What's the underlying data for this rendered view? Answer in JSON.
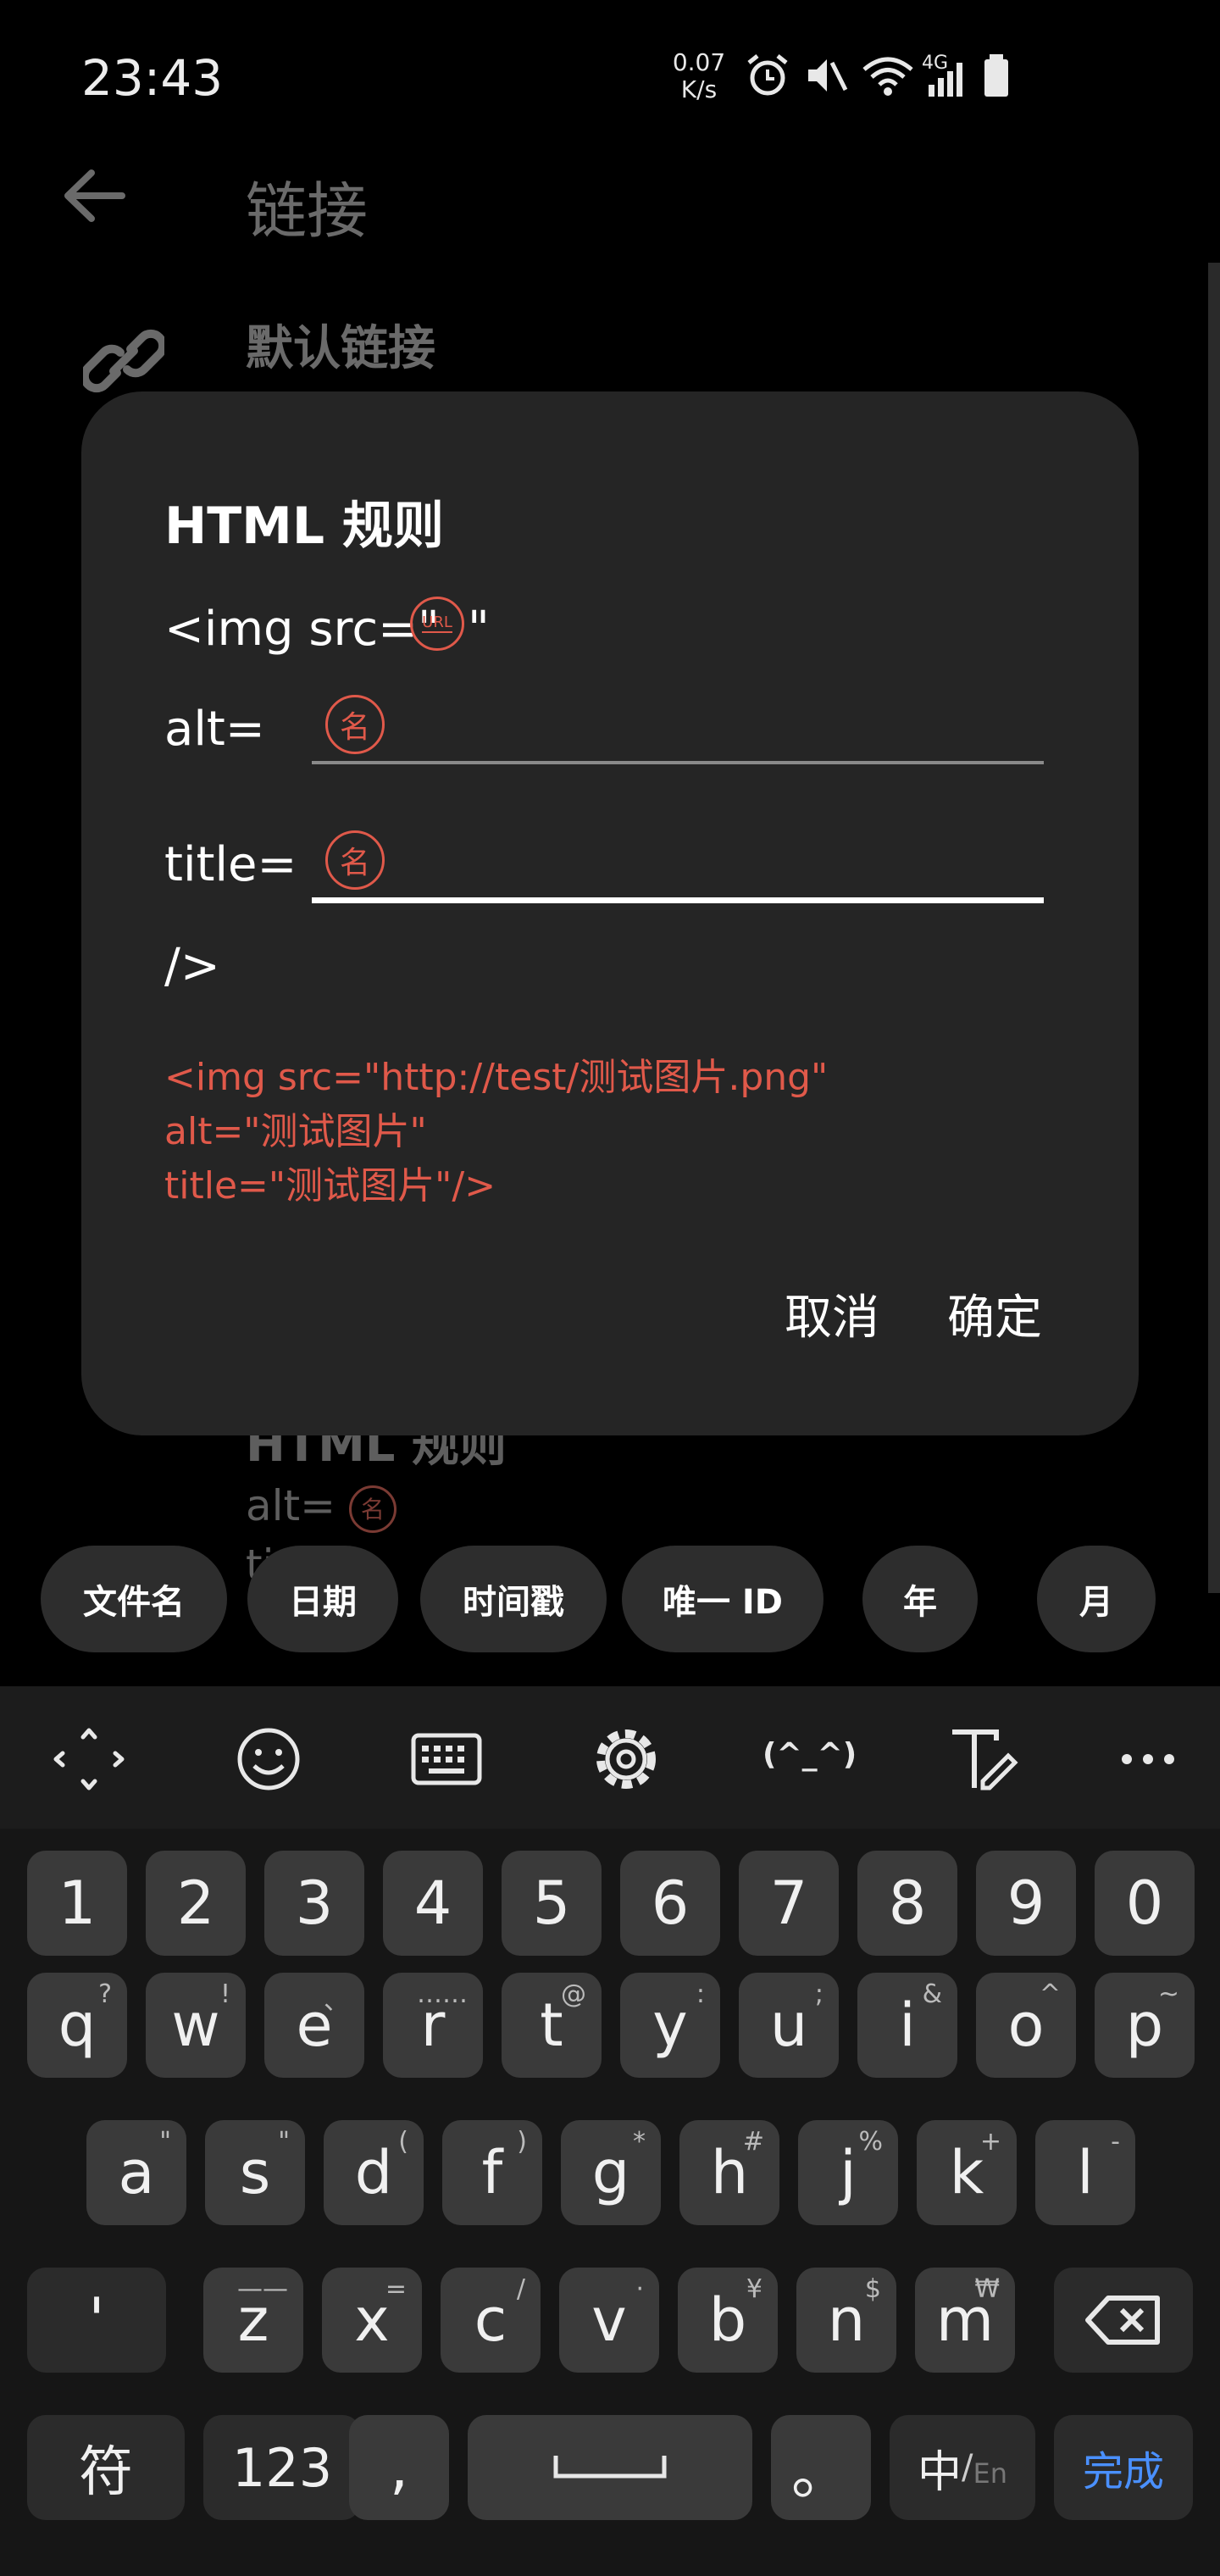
{
  "status_bar": {
    "time": "23:43",
    "net_speed_value": "0.07",
    "net_speed_unit": "K/s",
    "signal_label": "4G"
  },
  "background": {
    "page_title": "链接",
    "default_link_label": "默认链接",
    "html_rule_label": "HTML 规则",
    "alt_label": "alt=",
    "title_label": "ti"
  },
  "dialog": {
    "title": "HTML 规则",
    "img_open": "<img src=\"",
    "url_badge": "URL",
    "quote": "\"",
    "alt_label": "alt=",
    "title_label": "title=",
    "name_badge": "名",
    "close_tag": "/>",
    "preview": {
      "line1": "<img src=\"http://test/测试图片.png\"",
      "line2": "alt=\"测试图片\"",
      "line3": "title=\"测试图片\"/>"
    },
    "cancel": "取消",
    "confirm": "确定"
  },
  "chips": [
    "文件名",
    "日期",
    "时间戳",
    "唯一 ID",
    "年",
    "月"
  ],
  "keyboard": {
    "toolbar": [
      "move-icon",
      "emoji-icon",
      "keyboard-icon",
      "settings-icon",
      "kaomoji-icon",
      "text-edit-icon",
      "more-icon"
    ],
    "kaomoji": "(^_^)",
    "row_numbers": [
      "1",
      "2",
      "3",
      "4",
      "5",
      "6",
      "7",
      "8",
      "9",
      "0"
    ],
    "row_q": [
      {
        "k": "q",
        "h": "?"
      },
      {
        "k": "w",
        "h": "!"
      },
      {
        "k": "e",
        "h": "、"
      },
      {
        "k": "r",
        "h": "……"
      },
      {
        "k": "t",
        "h": "@"
      },
      {
        "k": "y",
        "h": ":"
      },
      {
        "k": "u",
        "h": ";"
      },
      {
        "k": "i",
        "h": "&"
      },
      {
        "k": "o",
        "h": "^"
      },
      {
        "k": "p",
        "h": "~"
      }
    ],
    "row_a": [
      {
        "k": "a",
        "h": "\""
      },
      {
        "k": "s",
        "h": "\""
      },
      {
        "k": "d",
        "h": "("
      },
      {
        "k": "f",
        "h": ")"
      },
      {
        "k": "g",
        "h": "*"
      },
      {
        "k": "h",
        "h": "#"
      },
      {
        "k": "j",
        "h": "%"
      },
      {
        "k": "k",
        "h": "+"
      },
      {
        "k": "l",
        "h": "-"
      }
    ],
    "apostrophe": "'",
    "row_z": [
      {
        "k": "z",
        "h": "——"
      },
      {
        "k": "x",
        "h": "="
      },
      {
        "k": "c",
        "h": "/"
      },
      {
        "k": "v",
        "h": "·"
      },
      {
        "k": "b",
        "h": "¥"
      },
      {
        "k": "n",
        "h": "$"
      },
      {
        "k": "m",
        "h": "₩"
      }
    ],
    "symbol": "符",
    "numbers": "123",
    "comma": ",",
    "period": "。",
    "lang_zh": "中",
    "lang_en": "En",
    "done": "完成"
  },
  "colors": {
    "accent": "#e0594a",
    "done_blue": "#4a90ff",
    "dialog_bg": "#252525"
  }
}
